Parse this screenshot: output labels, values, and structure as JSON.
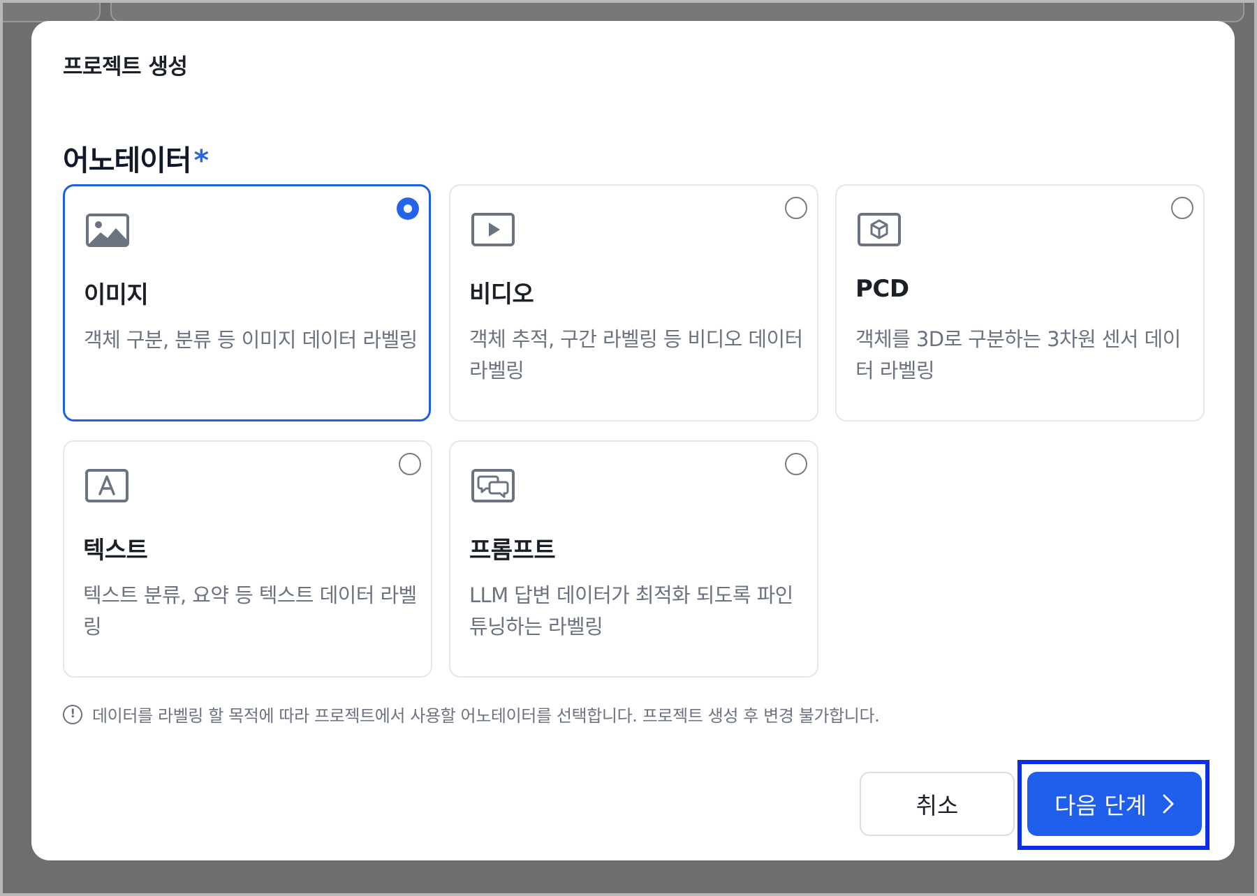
{
  "modal": {
    "title": "프로젝트 생성",
    "section_label": "어노테이터",
    "required_mark": "*"
  },
  "options": [
    {
      "id": "image",
      "icon": "image-icon",
      "title": "이미지",
      "description": "객체 구분, 분류 등 이미지 데이터 라벨링",
      "selected": true
    },
    {
      "id": "video",
      "icon": "video-play-icon",
      "title": "비디오",
      "description": "객체 추적, 구간 라벨링 등 비디오 데이터 라벨링",
      "selected": false
    },
    {
      "id": "pcd",
      "icon": "cube-icon",
      "title": "PCD",
      "description": "객체를 3D로 구분하는 3차원 센서 데이터 라벨링",
      "selected": false
    },
    {
      "id": "text",
      "icon": "text-a-icon",
      "title": "텍스트",
      "description": "텍스트 분류, 요약 등 텍스트 데이터 라벨링",
      "selected": false
    },
    {
      "id": "prompt",
      "icon": "chat-bubbles-icon",
      "title": "프롬프트",
      "description": "LLM 답변 데이터가 최적화 되도록 파인튜닝하는 라벨링",
      "selected": false
    }
  ],
  "notice": {
    "icon": "info-icon",
    "symbol": "!",
    "text": "데이터를 라벨링 할 목적에 따라 프로젝트에서 사용할 어노테이터를 선택합니다. 프로젝트 생성 후 변경 불가합니다."
  },
  "buttons": {
    "cancel_label": "취소",
    "next_label": "다음 단계",
    "next_icon": "chevron-right-icon"
  },
  "colors": {
    "accent": "#1f5fec",
    "selected_border": "#1d5ee8",
    "highlight_box": "#0a2fe6",
    "card_border": "#e3e6ec",
    "muted_text": "#6b7280"
  }
}
